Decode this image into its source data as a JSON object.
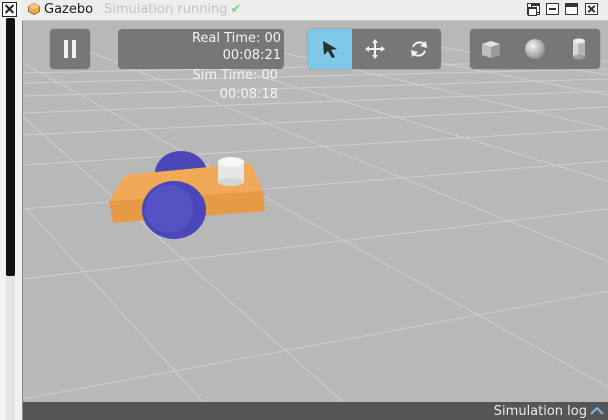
{
  "window": {
    "app_title": "Gazebo",
    "status_text": "Simulation running",
    "status_icon": "check-icon",
    "controls": [
      "restore-icon",
      "minimize-icon",
      "maximize-icon",
      "close-icon"
    ]
  },
  "toolbar": {
    "pause_icon": "pause-icon",
    "real_time_label": "Real Time: 00",
    "real_time_value": "00:08:21",
    "sim_time_label": "Sim Time: 00",
    "sim_time_value": "00:08:18",
    "modes": [
      {
        "name": "select",
        "icon": "cursor-arrow-icon",
        "active": true
      },
      {
        "name": "translate",
        "icon": "move-arrows-icon",
        "active": false
      },
      {
        "name": "rotate",
        "icon": "rotate-icon",
        "active": false
      }
    ],
    "shapes": [
      {
        "name": "box",
        "icon": "box-icon"
      },
      {
        "name": "sphere",
        "icon": "sphere-icon"
      },
      {
        "name": "cylinder",
        "icon": "cylinder-icon"
      }
    ]
  },
  "bottom_bar": {
    "sim_log_label": "Simulation log",
    "toggle_icon": "chevron-up-icon"
  },
  "colors": {
    "ground": "#b8b8b8",
    "grid_lines": "#d0d0d0",
    "robot_body": "#f0a050",
    "wheels": "#4a48b8",
    "sensor": "#e8e8e8",
    "active_mode": "#7ec8ea",
    "overlay_button": "#777777"
  }
}
